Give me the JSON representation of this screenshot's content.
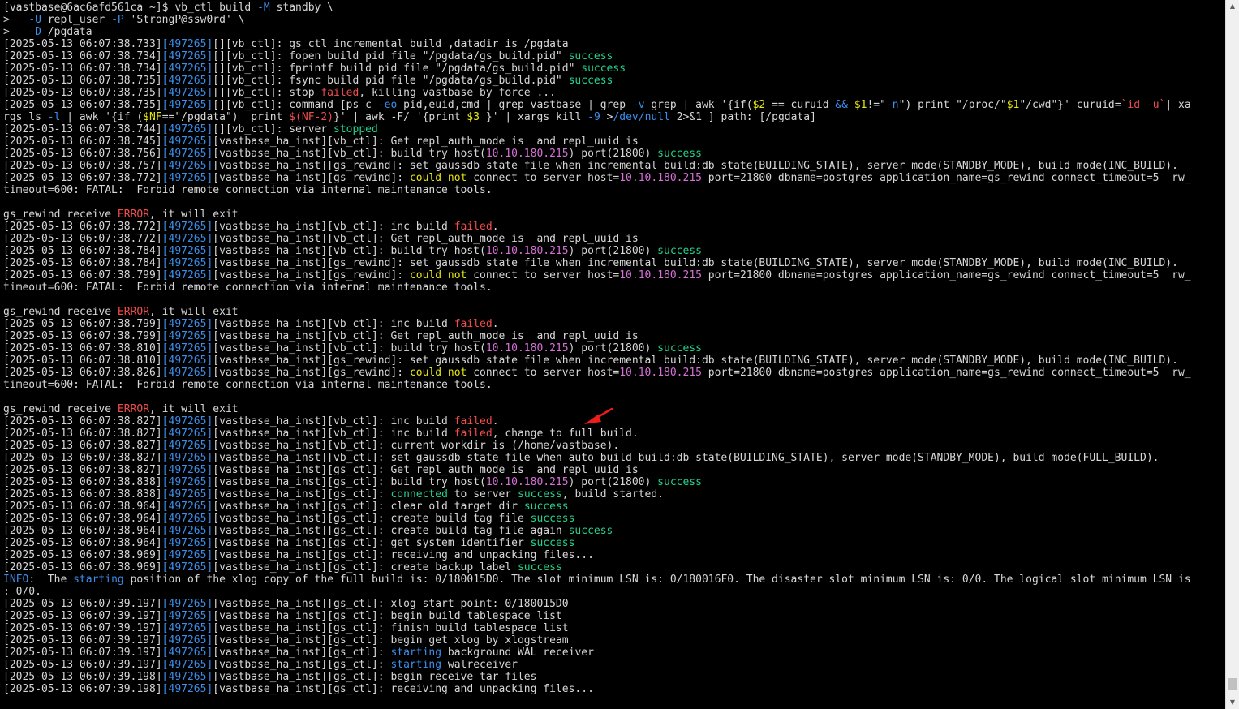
{
  "colors": {
    "default": "#d7d7d7",
    "pid": "#3b8eea",
    "success": "#23d18b",
    "failed": "#f14c4c",
    "ip": "#d670d6",
    "option": "#3b8eea",
    "yellow": "#e5e510",
    "annotation_arrow": "#ee1c1c"
  },
  "terminal": {
    "lines": [
      [
        [
          "[vastbase@6ac6afd561ca ~]$ vb_ctl build ",
          "default"
        ],
        [
          "-M",
          "option"
        ],
        [
          " standby \\",
          "default"
        ]
      ],
      [
        [
          ">   ",
          "default"
        ],
        [
          "-U",
          "option"
        ],
        [
          " repl_user ",
          "default"
        ],
        [
          "-P",
          "option"
        ],
        [
          " 'StrongP@ssw0rd' \\",
          "default"
        ]
      ],
      [
        [
          ">   ",
          "default"
        ],
        [
          "-D",
          "option"
        ],
        [
          " /pgdata",
          "default"
        ]
      ],
      [
        [
          "[2025-05-13 06:07:38.733]",
          "default"
        ],
        [
          "[497265]",
          "pid"
        ],
        [
          "[][vb_ctl]: gs_ctl incremental build ,datadir is /pgdata",
          "default"
        ]
      ],
      [
        [
          "[2025-05-13 06:07:38.734]",
          "default"
        ],
        [
          "[497265]",
          "pid"
        ],
        [
          "[][vb_ctl]: fopen build pid file \"/pgdata/gs_build.pid\" ",
          "default"
        ],
        [
          "success",
          "success"
        ]
      ],
      [
        [
          "[2025-05-13 06:07:38.734]",
          "default"
        ],
        [
          "[497265]",
          "pid"
        ],
        [
          "[][vb_ctl]: fprintf build pid file \"/pgdata/gs_build.pid\" ",
          "default"
        ],
        [
          "success",
          "success"
        ]
      ],
      [
        [
          "[2025-05-13 06:07:38.735]",
          "default"
        ],
        [
          "[497265]",
          "pid"
        ],
        [
          "[][vb_ctl]: fsync build pid file \"/pgdata/gs_build.pid\" ",
          "default"
        ],
        [
          "success",
          "success"
        ]
      ],
      [
        [
          "[2025-05-13 06:07:38.735]",
          "default"
        ],
        [
          "[497265]",
          "pid"
        ],
        [
          "[][vb_ctl]: stop ",
          "default"
        ],
        [
          "failed",
          "failed"
        ],
        [
          ", killing vastbase by force ...",
          "default"
        ]
      ],
      [
        [
          "[2025-05-13 06:07:38.735]",
          "default"
        ],
        [
          "[497265]",
          "pid"
        ],
        [
          "[][vb_ctl]: command [ps c ",
          "default"
        ],
        [
          "-eo",
          "option"
        ],
        [
          " pid,euid,cmd | grep vastbase | grep ",
          "default"
        ],
        [
          "-v",
          "option"
        ],
        [
          " grep | awk '{if(",
          "default"
        ],
        [
          "$2",
          "yellow"
        ],
        [
          " == curuid ",
          "default"
        ],
        [
          "&&",
          "option"
        ],
        [
          " ",
          "default"
        ],
        [
          "$1",
          "yellow"
        ],
        [
          "!=\"",
          "default"
        ],
        [
          "-n",
          "option"
        ],
        [
          "\") print \"/proc/\"",
          "default"
        ],
        [
          "$1",
          "yellow"
        ],
        [
          "\"/cwd\"}' curuid=",
          "default"
        ],
        [
          "`id -u`",
          "failed"
        ],
        [
          "| xa",
          "default"
        ]
      ],
      [
        [
          "rgs ls ",
          "default"
        ],
        [
          "-l",
          "option"
        ],
        [
          " | awk '{if (",
          "default"
        ],
        [
          "$NF",
          "yellow"
        ],
        [
          "==\"/pgdata\")  print ",
          "default"
        ],
        [
          "$(NF-2)",
          "failed"
        ],
        [
          "}' | awk -F/ '{print ",
          "default"
        ],
        [
          "$3",
          "yellow"
        ],
        [
          " }' | xargs kill ",
          "default"
        ],
        [
          "-9",
          "option"
        ],
        [
          " >",
          "default"
        ],
        [
          "/dev/null",
          "option"
        ],
        [
          " 2>&1 ] path: [/pgdata]",
          "default"
        ]
      ],
      [
        [
          "[2025-05-13 06:07:38.744]",
          "default"
        ],
        [
          "[497265]",
          "pid"
        ],
        [
          "[][vb_ctl]: server ",
          "default"
        ],
        [
          "stopped",
          "success"
        ]
      ],
      [
        [
          "[2025-05-13 06:07:38.745]",
          "default"
        ],
        [
          "[497265]",
          "pid"
        ],
        [
          "[vastbase_ha_inst][vb_ctl]: Get repl_auth_mode is  and repl_uuid is",
          "default"
        ]
      ],
      [
        [
          "[2025-05-13 06:07:38.756]",
          "default"
        ],
        [
          "[497265]",
          "pid"
        ],
        [
          "[vastbase_ha_inst][vb_ctl]: build try host(",
          "default"
        ],
        [
          "10.10.180.215",
          "ip"
        ],
        [
          ") port(21800) ",
          "default"
        ],
        [
          "success",
          "success"
        ]
      ],
      [
        [
          "[2025-05-13 06:07:38.757]",
          "default"
        ],
        [
          "[497265]",
          "pid"
        ],
        [
          "[vastbase_ha_inst][gs_rewind]: set gaussdb state file when incremental build:db state(BUILDING_STATE), server mode(STANDBY_MODE), build mode(INC_BUILD).",
          "default"
        ]
      ],
      [
        [
          "[2025-05-13 06:07:38.772]",
          "default"
        ],
        [
          "[497265]",
          "pid"
        ],
        [
          "[vastbase_ha_inst][gs_rewind]: ",
          "default"
        ],
        [
          "could not",
          "yellow"
        ],
        [
          " connect to server host=",
          "default"
        ],
        [
          "10.10.180.215",
          "ip"
        ],
        [
          " port=21800 dbname=postgres application_name=gs_rewind connect_timeout=5  rw_",
          "default"
        ]
      ],
      [
        [
          "timeout=600: FATAL:  Forbid remote connection via internal maintenance tools.",
          "default"
        ]
      ],
      [
        [
          "",
          "default"
        ]
      ],
      [
        [
          "gs_rewind receive ",
          "default"
        ],
        [
          "ERROR",
          "failed"
        ],
        [
          ", it will exit",
          "default"
        ]
      ],
      [
        [
          "[2025-05-13 06:07:38.772]",
          "default"
        ],
        [
          "[497265]",
          "pid"
        ],
        [
          "[vastbase_ha_inst][vb_ctl]: inc build ",
          "default"
        ],
        [
          "failed",
          "failed"
        ],
        [
          ".",
          "default"
        ]
      ],
      [
        [
          "[2025-05-13 06:07:38.772]",
          "default"
        ],
        [
          "[497265]",
          "pid"
        ],
        [
          "[vastbase_ha_inst][vb_ctl]: Get repl_auth_mode is  and repl_uuid is",
          "default"
        ]
      ],
      [
        [
          "[2025-05-13 06:07:38.784]",
          "default"
        ],
        [
          "[497265]",
          "pid"
        ],
        [
          "[vastbase_ha_inst][vb_ctl]: build try host(",
          "default"
        ],
        [
          "10.10.180.215",
          "ip"
        ],
        [
          ") port(21800) ",
          "default"
        ],
        [
          "success",
          "success"
        ]
      ],
      [
        [
          "[2025-05-13 06:07:38.784]",
          "default"
        ],
        [
          "[497265]",
          "pid"
        ],
        [
          "[vastbase_ha_inst][gs_rewind]: set gaussdb state file when incremental build:db state(BUILDING_STATE), server mode(STANDBY_MODE), build mode(INC_BUILD).",
          "default"
        ]
      ],
      [
        [
          "[2025-05-13 06:07:38.799]",
          "default"
        ],
        [
          "[497265]",
          "pid"
        ],
        [
          "[vastbase_ha_inst][gs_rewind]: ",
          "default"
        ],
        [
          "could not",
          "yellow"
        ],
        [
          " connect to server host=",
          "default"
        ],
        [
          "10.10.180.215",
          "ip"
        ],
        [
          " port=21800 dbname=postgres application_name=gs_rewind connect_timeout=5  rw_",
          "default"
        ]
      ],
      [
        [
          "timeout=600: FATAL:  Forbid remote connection via internal maintenance tools.",
          "default"
        ]
      ],
      [
        [
          "",
          "default"
        ]
      ],
      [
        [
          "gs_rewind receive ",
          "default"
        ],
        [
          "ERROR",
          "failed"
        ],
        [
          ", it will exit",
          "default"
        ]
      ],
      [
        [
          "[2025-05-13 06:07:38.799]",
          "default"
        ],
        [
          "[497265]",
          "pid"
        ],
        [
          "[vastbase_ha_inst][vb_ctl]: inc build ",
          "default"
        ],
        [
          "failed",
          "failed"
        ],
        [
          ".",
          "default"
        ]
      ],
      [
        [
          "[2025-05-13 06:07:38.799]",
          "default"
        ],
        [
          "[497265]",
          "pid"
        ],
        [
          "[vastbase_ha_inst][vb_ctl]: Get repl_auth_mode is  and repl_uuid is",
          "default"
        ]
      ],
      [
        [
          "[2025-05-13 06:07:38.810]",
          "default"
        ],
        [
          "[497265]",
          "pid"
        ],
        [
          "[vastbase_ha_inst][vb_ctl]: build try host(",
          "default"
        ],
        [
          "10.10.180.215",
          "ip"
        ],
        [
          ") port(21800) ",
          "default"
        ],
        [
          "success",
          "success"
        ]
      ],
      [
        [
          "[2025-05-13 06:07:38.810]",
          "default"
        ],
        [
          "[497265]",
          "pid"
        ],
        [
          "[vastbase_ha_inst][gs_rewind]: set gaussdb state file when incremental build:db state(BUILDING_STATE), server mode(STANDBY_MODE), build mode(INC_BUILD).",
          "default"
        ]
      ],
      [
        [
          "[2025-05-13 06:07:38.826]",
          "default"
        ],
        [
          "[497265]",
          "pid"
        ],
        [
          "[vastbase_ha_inst][gs_rewind]: ",
          "default"
        ],
        [
          "could not",
          "yellow"
        ],
        [
          " connect to server host=",
          "default"
        ],
        [
          "10.10.180.215",
          "ip"
        ],
        [
          " port=21800 dbname=postgres application_name=gs_rewind connect_timeout=5  rw_",
          "default"
        ]
      ],
      [
        [
          "timeout=600: FATAL:  Forbid remote connection via internal maintenance tools.",
          "default"
        ]
      ],
      [
        [
          "",
          "default"
        ]
      ],
      [
        [
          "gs_rewind receive ",
          "default"
        ],
        [
          "ERROR",
          "failed"
        ],
        [
          ", it will exit",
          "default"
        ]
      ],
      [
        [
          "[2025-05-13 06:07:38.827]",
          "default"
        ],
        [
          "[497265]",
          "pid"
        ],
        [
          "[vastbase_ha_inst][vb_ctl]: inc build ",
          "default"
        ],
        [
          "failed",
          "failed"
        ],
        [
          ".",
          "default"
        ]
      ],
      [
        [
          "[2025-05-13 06:07:38.827]",
          "default"
        ],
        [
          "[497265]",
          "pid"
        ],
        [
          "[vastbase_ha_inst][vb_ctl]: inc build ",
          "default"
        ],
        [
          "failed",
          "failed"
        ],
        [
          ", change to full build.",
          "default"
        ]
      ],
      [
        [
          "[2025-05-13 06:07:38.827]",
          "default"
        ],
        [
          "[497265]",
          "pid"
        ],
        [
          "[vastbase_ha_inst][vb_ctl]: current workdir is (/home/vastbase).",
          "default"
        ]
      ],
      [
        [
          "[2025-05-13 06:07:38.827]",
          "default"
        ],
        [
          "[497265]",
          "pid"
        ],
        [
          "[vastbase_ha_inst][vb_ctl]: set gaussdb state file when auto build build:db state(BUILDING_STATE), server mode(STANDBY_MODE), build mode(FULL_BUILD).",
          "default"
        ]
      ],
      [
        [
          "[2025-05-13 06:07:38.827]",
          "default"
        ],
        [
          "[497265]",
          "pid"
        ],
        [
          "[vastbase_ha_inst][gs_ctl]: Get repl_auth_mode is  and repl_uuid is",
          "default"
        ]
      ],
      [
        [
          "[2025-05-13 06:07:38.838]",
          "default"
        ],
        [
          "[497265]",
          "pid"
        ],
        [
          "[vastbase_ha_inst][gs_ctl]: build try host(",
          "default"
        ],
        [
          "10.10.180.215",
          "ip"
        ],
        [
          ") port(21800) ",
          "default"
        ],
        [
          "success",
          "success"
        ]
      ],
      [
        [
          "[2025-05-13 06:07:38.838]",
          "default"
        ],
        [
          "[497265]",
          "pid"
        ],
        [
          "[vastbase_ha_inst][gs_ctl]: ",
          "default"
        ],
        [
          "connected",
          "success"
        ],
        [
          " to server ",
          "default"
        ],
        [
          "success",
          "success"
        ],
        [
          ", build started.",
          "default"
        ]
      ],
      [
        [
          "[2025-05-13 06:07:38.964]",
          "default"
        ],
        [
          "[497265]",
          "pid"
        ],
        [
          "[vastbase_ha_inst][gs_ctl]: clear old target dir ",
          "default"
        ],
        [
          "success",
          "success"
        ]
      ],
      [
        [
          "[2025-05-13 06:07:38.964]",
          "default"
        ],
        [
          "[497265]",
          "pid"
        ],
        [
          "[vastbase_ha_inst][gs_ctl]: create build tag file ",
          "default"
        ],
        [
          "success",
          "success"
        ]
      ],
      [
        [
          "[2025-05-13 06:07:38.964]",
          "default"
        ],
        [
          "[497265]",
          "pid"
        ],
        [
          "[vastbase_ha_inst][gs_ctl]: create build tag file again ",
          "default"
        ],
        [
          "success",
          "success"
        ]
      ],
      [
        [
          "[2025-05-13 06:07:38.964]",
          "default"
        ],
        [
          "[497265]",
          "pid"
        ],
        [
          "[vastbase_ha_inst][gs_ctl]: get system identifier ",
          "default"
        ],
        [
          "success",
          "success"
        ]
      ],
      [
        [
          "[2025-05-13 06:07:38.969]",
          "default"
        ],
        [
          "[497265]",
          "pid"
        ],
        [
          "[vastbase_ha_inst][gs_ctl]: receiving and unpacking files...",
          "default"
        ]
      ],
      [
        [
          "[2025-05-13 06:07:38.969]",
          "default"
        ],
        [
          "[497265]",
          "pid"
        ],
        [
          "[vastbase_ha_inst][gs_ctl]: create backup label ",
          "default"
        ],
        [
          "success",
          "success"
        ]
      ],
      [
        [
          "INFO",
          "pid"
        ],
        [
          ":  The ",
          "default"
        ],
        [
          "starting",
          "pid"
        ],
        [
          " position of the xlog copy of the full build is: 0/180015D0. The slot minimum LSN is: 0/180016F0. The disaster slot minimum LSN is: 0/0. The logical slot minimum LSN is",
          "default"
        ]
      ],
      [
        [
          ": 0/0.",
          "default"
        ]
      ],
      [
        [
          "[2025-05-13 06:07:39.197]",
          "default"
        ],
        [
          "[497265]",
          "pid"
        ],
        [
          "[vastbase_ha_inst][gs_ctl]: xlog start point: 0/180015D0",
          "default"
        ]
      ],
      [
        [
          "[2025-05-13 06:07:39.197]",
          "default"
        ],
        [
          "[497265]",
          "pid"
        ],
        [
          "[vastbase_ha_inst][gs_ctl]: begin build tablespace list",
          "default"
        ]
      ],
      [
        [
          "[2025-05-13 06:07:39.197]",
          "default"
        ],
        [
          "[497265]",
          "pid"
        ],
        [
          "[vastbase_ha_inst][gs_ctl]: finish build tablespace list",
          "default"
        ]
      ],
      [
        [
          "[2025-05-13 06:07:39.197]",
          "default"
        ],
        [
          "[497265]",
          "pid"
        ],
        [
          "[vastbase_ha_inst][gs_ctl]: begin get xlog by xlogstream",
          "default"
        ]
      ],
      [
        [
          "[2025-05-13 06:07:39.197]",
          "default"
        ],
        [
          "[497265]",
          "pid"
        ],
        [
          "[vastbase_ha_inst][gs_ctl]: ",
          "default"
        ],
        [
          "starting",
          "pid"
        ],
        [
          " background WAL receiver",
          "default"
        ]
      ],
      [
        [
          "[2025-05-13 06:07:39.197]",
          "default"
        ],
        [
          "[497265]",
          "pid"
        ],
        [
          "[vastbase_ha_inst][gs_ctl]: ",
          "default"
        ],
        [
          "starting",
          "pid"
        ],
        [
          " walreceiver",
          "default"
        ]
      ],
      [
        [
          "[2025-05-13 06:07:39.198]",
          "default"
        ],
        [
          "[497265]",
          "pid"
        ],
        [
          "[vastbase_ha_inst][gs_ctl]: begin receive tar files",
          "default"
        ]
      ],
      [
        [
          "[2025-05-13 06:07:39.198]",
          "default"
        ],
        [
          "[497265]",
          "pid"
        ],
        [
          "[vastbase_ha_inst][gs_ctl]: receiving and unpacking files...",
          "default"
        ]
      ]
    ]
  },
  "scrollbar": {
    "up_icon": "▲",
    "down_icon": "▼"
  },
  "icons": {
    "annotation": "red-arrow-icon",
    "scroll_up": "scroll-up-arrow-icon",
    "scroll_down": "scroll-down-arrow-icon"
  }
}
